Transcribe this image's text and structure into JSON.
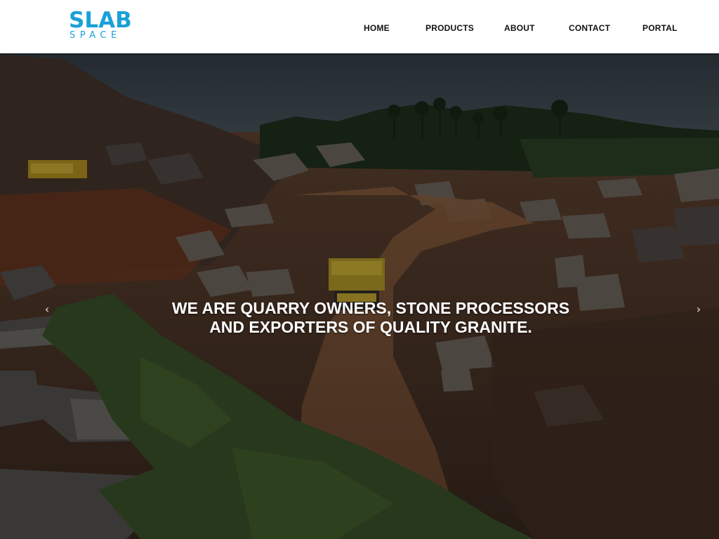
{
  "brand": {
    "line1": "SLAB",
    "line2": "SPACE",
    "color": "#1aa0d8"
  },
  "nav": [
    {
      "label": "HOME"
    },
    {
      "label": "PRODUCTS"
    },
    {
      "label": "ABOUT"
    },
    {
      "label": "CONTACT"
    },
    {
      "label": "PORTAL"
    }
  ],
  "hero": {
    "headline_line1": "WE ARE QUARRY OWNERS, STONE PROCESSORS",
    "headline_line2": "AND EXPORTERS OF QUALITY GRANITE.",
    "prev_icon": "chevron-left-icon",
    "next_icon": "chevron-right-icon",
    "prev_glyph": "‹",
    "next_glyph": "›"
  }
}
